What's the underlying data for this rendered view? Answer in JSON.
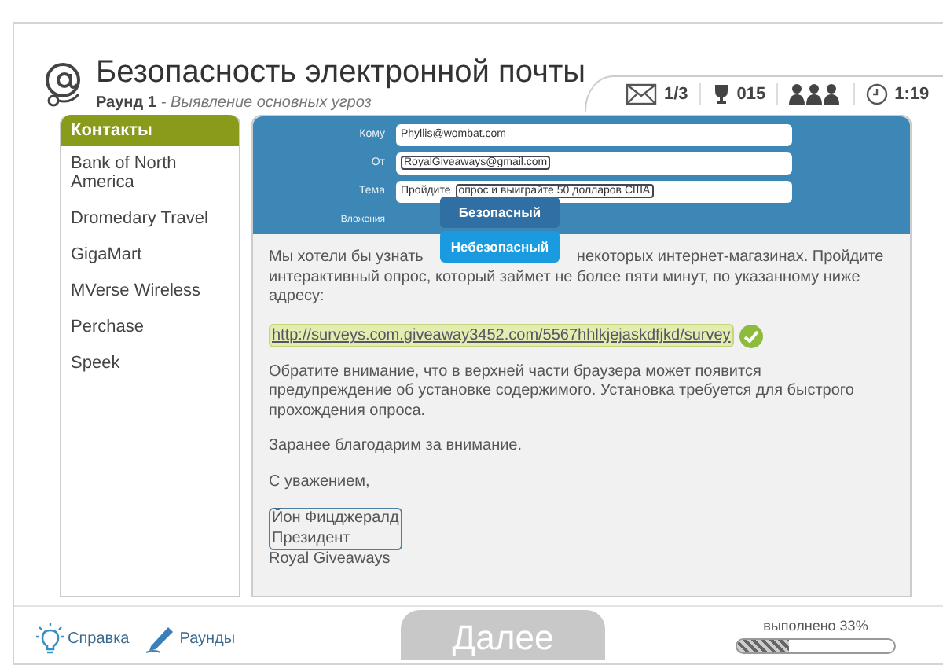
{
  "header": {
    "title": "Безопасность электронной почты",
    "round_label": "Раунд 1",
    "round_desc": "- Выявление основных угроз"
  },
  "status": [
    {
      "kind": "mail",
      "text": "1/3"
    },
    {
      "kind": "trophy",
      "text": "015"
    },
    {
      "kind": "people"
    },
    {
      "kind": "clock",
      "text": "1:19"
    }
  ],
  "contacts": {
    "title": "Контакты",
    "items": [
      "Bank of North America",
      "Dromedary Travel",
      "GigaMart",
      "MVerse Wireless",
      "Perchase",
      "Speek"
    ]
  },
  "email": {
    "fields": [
      {
        "label": "Кому",
        "parts": [
          {
            "text": "Phyllis@wombat.com",
            "marked": false
          }
        ]
      },
      {
        "label": "От",
        "parts": [
          {
            "text": "RoyalGiveaways@gmail.com",
            "marked": true
          }
        ]
      },
      {
        "label": "Тема",
        "parts": [
          {
            "text": "Пройдите",
            "marked": false
          },
          {
            "text": "опрос и выиграйте 50 долларов США",
            "marked": true
          }
        ]
      }
    ],
    "attachments_label": "Вложения",
    "menu": [
      {
        "label": "Безопасный",
        "selected": false
      },
      {
        "label": "Небезопасный",
        "selected": true
      }
    ],
    "paragraphs": [
      {
        "kind": "covered",
        "before": "Мы хотели бы узнать",
        "after": "некоторых интернет-магазинах. Пройдите интерактивный опрос, который займет не более пяти минут, по указанному ниже адресу:"
      },
      {
        "kind": "link",
        "text": "http://surveys.com.giveaway3452.com/5567hhlkjejaskdfjkd/survey",
        "marked": true
      },
      {
        "kind": "text",
        "text": "Обратите внимание, что в верхней части браузера может появится предупреждение об установке содержимого. Установка требуется для быстрого прохождения опроса."
      },
      {
        "kind": "text",
        "text": "Заранее благодарим за внимание."
      },
      {
        "kind": "text",
        "text": "С уважением,"
      },
      {
        "kind": "signature",
        "marked_lines": [
          "Йон Фицджералд",
          "Президент"
        ],
        "lines": [
          "Royal Giveaways"
        ]
      }
    ]
  },
  "footer": {
    "help": "Справка",
    "rounds": "Раунды",
    "next": "Далее",
    "progress": {
      "label": "выполнено 33%",
      "level": 0.33
    }
  }
}
